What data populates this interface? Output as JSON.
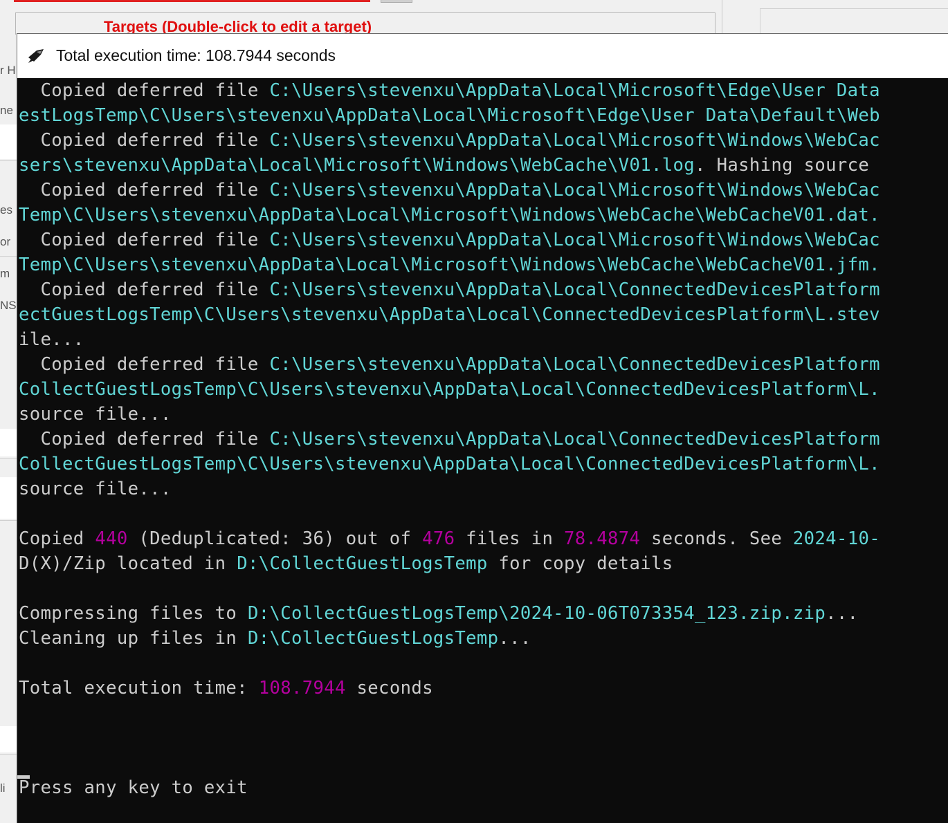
{
  "background": {
    "targets_title": "Targets (Double-click to edit a target)",
    "left_fragments": [
      "r H",
      "ne",
      "es",
      "or",
      "m",
      "NS",
      "li"
    ]
  },
  "console": {
    "title": "Total execution time: 108.7944 seconds",
    "icon": "terminal-app-icon",
    "colors": {
      "background": "#0c0c0c",
      "text": "#cccccc",
      "path": "#61d6d6",
      "number": "#b4009e"
    },
    "lines": [
      {
        "segments": [
          {
            "t": "  Copied deferred file ",
            "c": "w"
          },
          {
            "t": "C:\\Users\\stevenxu\\AppData\\Local\\Microsoft\\Edge\\User Data",
            "c": "c"
          }
        ]
      },
      {
        "segments": [
          {
            "t": "estLogsTemp\\C\\Users\\stevenxu\\AppData\\Local\\Microsoft\\Edge\\User Data\\Default\\Web",
            "c": "c"
          }
        ]
      },
      {
        "segments": [
          {
            "t": "  Copied deferred file ",
            "c": "w"
          },
          {
            "t": "C:\\Users\\stevenxu\\AppData\\Local\\Microsoft\\Windows\\WebCac",
            "c": "c"
          }
        ]
      },
      {
        "segments": [
          {
            "t": "sers\\stevenxu\\AppData\\Local\\Microsoft\\Windows\\WebCache\\V01.log",
            "c": "c"
          },
          {
            "t": ". Hashing source ",
            "c": "w"
          }
        ]
      },
      {
        "segments": [
          {
            "t": "  Copied deferred file ",
            "c": "w"
          },
          {
            "t": "C:\\Users\\stevenxu\\AppData\\Local\\Microsoft\\Windows\\WebCac",
            "c": "c"
          }
        ]
      },
      {
        "segments": [
          {
            "t": "Temp\\C\\Users\\stevenxu\\AppData\\Local\\Microsoft\\Windows\\WebCache\\WebCacheV01.dat.",
            "c": "c"
          }
        ]
      },
      {
        "segments": [
          {
            "t": "  Copied deferred file ",
            "c": "w"
          },
          {
            "t": "C:\\Users\\stevenxu\\AppData\\Local\\Microsoft\\Windows\\WebCac",
            "c": "c"
          }
        ]
      },
      {
        "segments": [
          {
            "t": "Temp\\C\\Users\\stevenxu\\AppData\\Local\\Microsoft\\Windows\\WebCache\\WebCacheV01.jfm.",
            "c": "c"
          }
        ]
      },
      {
        "segments": [
          {
            "t": "  Copied deferred file ",
            "c": "w"
          },
          {
            "t": "C:\\Users\\stevenxu\\AppData\\Local\\ConnectedDevicesPlatform",
            "c": "c"
          }
        ]
      },
      {
        "segments": [
          {
            "t": "ectGuestLogsTemp\\C\\Users\\stevenxu\\AppData\\Local\\ConnectedDevicesPlatform\\L.stev",
            "c": "c"
          }
        ]
      },
      {
        "segments": [
          {
            "t": "ile...",
            "c": "w"
          }
        ]
      },
      {
        "segments": [
          {
            "t": "  Copied deferred file ",
            "c": "w"
          },
          {
            "t": "C:\\Users\\stevenxu\\AppData\\Local\\ConnectedDevicesPlatform",
            "c": "c"
          }
        ]
      },
      {
        "segments": [
          {
            "t": "CollectGuestLogsTemp\\C\\Users\\stevenxu\\AppData\\Local\\ConnectedDevicesPlatform\\L.",
            "c": "c"
          }
        ]
      },
      {
        "segments": [
          {
            "t": "source file...",
            "c": "w"
          }
        ]
      },
      {
        "segments": [
          {
            "t": "  Copied deferred file ",
            "c": "w"
          },
          {
            "t": "C:\\Users\\stevenxu\\AppData\\Local\\ConnectedDevicesPlatform",
            "c": "c"
          }
        ]
      },
      {
        "segments": [
          {
            "t": "CollectGuestLogsTemp\\C\\Users\\stevenxu\\AppData\\Local\\ConnectedDevicesPlatform\\L.",
            "c": "c"
          }
        ]
      },
      {
        "segments": [
          {
            "t": "source file...",
            "c": "w"
          }
        ]
      },
      {
        "segments": []
      },
      {
        "segments": [
          {
            "t": "Copied ",
            "c": "w"
          },
          {
            "t": "440",
            "c": "m"
          },
          {
            "t": " (Deduplicated: 36) out of ",
            "c": "w"
          },
          {
            "t": "476",
            "c": "m"
          },
          {
            "t": " files in ",
            "c": "w"
          },
          {
            "t": "78.4874",
            "c": "m"
          },
          {
            "t": " seconds. See ",
            "c": "w"
          },
          {
            "t": "2024-10-",
            "c": "c"
          }
        ]
      },
      {
        "segments": [
          {
            "t": "D(X)/Zip located in ",
            "c": "w"
          },
          {
            "t": "D:\\CollectGuestLogsTemp",
            "c": "c"
          },
          {
            "t": " for copy details",
            "c": "w"
          }
        ]
      },
      {
        "segments": []
      },
      {
        "segments": [
          {
            "t": "Compressing files to ",
            "c": "w"
          },
          {
            "t": "D:\\CollectGuestLogsTemp\\2024-10-06T073354_123.zip.zip",
            "c": "c"
          },
          {
            "t": "...",
            "c": "w"
          }
        ]
      },
      {
        "segments": [
          {
            "t": "Cleaning up files in ",
            "c": "w"
          },
          {
            "t": "D:\\CollectGuestLogsTemp",
            "c": "c"
          },
          {
            "t": "...",
            "c": "w"
          }
        ]
      },
      {
        "segments": []
      },
      {
        "segments": [
          {
            "t": "Total execution time: ",
            "c": "w"
          },
          {
            "t": "108.7944",
            "c": "m"
          },
          {
            "t": " seconds",
            "c": "w"
          }
        ]
      },
      {
        "segments": []
      },
      {
        "segments": []
      },
      {
        "segments": []
      },
      {
        "segments": [
          {
            "t": "Press any key to exit",
            "c": "w"
          }
        ]
      }
    ]
  }
}
